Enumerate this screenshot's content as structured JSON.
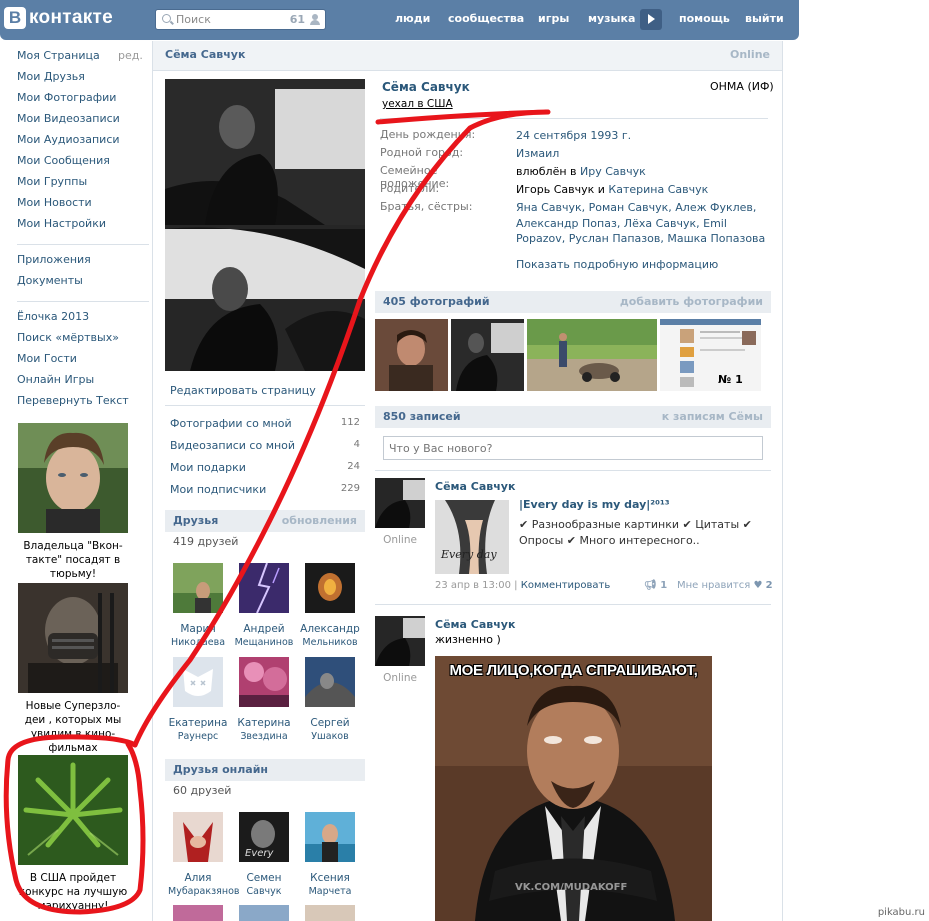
{
  "header": {
    "logo_letter": "В",
    "logo_text": "контакте",
    "search_placeholder": "Поиск",
    "search_count": "61",
    "nav": [
      "люди",
      "сообщества",
      "игры",
      "музыка",
      "помощь",
      "выйти"
    ]
  },
  "left_menu": {
    "edit": "ред.",
    "group1": [
      "Моя Страница",
      "Мои Друзья",
      "Мои Фотографии",
      "Мои Видеозаписи",
      "Мои Аудиозаписи",
      "Мои Сообщения",
      "Мои Группы",
      "Мои Новости",
      "Мои Настройки"
    ],
    "group2": [
      "Приложения",
      "Документы"
    ],
    "group3": [
      "Ёлочка 2013",
      "Поиск «мёртвых»",
      "Мои Гости",
      "Онлайн Игры",
      "Перевернуть Текст"
    ]
  },
  "ads": [
    {
      "text": "Владельца \"Вкон-такте\" посадят в тюрьму!"
    },
    {
      "text": "Новые Суперзло-деи , которых мы увидим в кино-фильмах"
    },
    {
      "text": "В США пройдет конкурс на лучшую марихуанну!"
    }
  ],
  "page_header": {
    "name": "Сёма Савчук",
    "online": "Online"
  },
  "sidebar": {
    "edit_page": "Редактировать страницу",
    "counters": [
      {
        "label": "Фотографии со мной",
        "count": "112"
      },
      {
        "label": "Видеозаписи со мной",
        "count": "4"
      },
      {
        "label": "Мои подарки",
        "count": "24"
      },
      {
        "label": "Мои подписчики",
        "count": "229"
      }
    ],
    "friends": {
      "title": "Друзья",
      "action": "обновления",
      "count_text": "419 друзей",
      "items": [
        {
          "first": "Мария",
          "last": "Николаева"
        },
        {
          "first": "Андрей",
          "last": "Мещанинов"
        },
        {
          "first": "Александр",
          "last": "Мельников"
        },
        {
          "first": "Екатерина",
          "last": "Раунерс"
        },
        {
          "first": "Катерина",
          "last": "Звездина"
        },
        {
          "first": "Сергей",
          "last": "Ушаков"
        }
      ]
    },
    "friends_online": {
      "title": "Друзья онлайн",
      "count_text": "60 друзей",
      "items": [
        {
          "first": "Алия",
          "last": "Мубаракзянов"
        },
        {
          "first": "Семен",
          "last": "Савчук"
        },
        {
          "first": "Ксения",
          "last": "Марчета"
        }
      ]
    }
  },
  "profile": {
    "name": "Сёма Савчук",
    "status": "уехал в США",
    "university": "ОНМА (ИФ)",
    "rows": [
      {
        "label": "День рождения:",
        "value": "24 сентября 1993 г."
      },
      {
        "label": "Родной город:",
        "value": "Измаил"
      },
      {
        "label": "Семейное положение:",
        "value_plain": "влюблён в",
        "value": "Иру Савчук"
      },
      {
        "label": "Родители:",
        "value_a": "Игорь Савчук",
        "value_and": "и",
        "value_b": "Катерина Савчук"
      },
      {
        "label": "Братья, сёстры:",
        "value": "Яна Савчук, Роман Савчук, Алеж Фуклев, Александр Попаз, Лёха Савчук, Emil Popazov, Руслан Папазов, Машка Попазова"
      }
    ],
    "show_more": "Показать подробную информацию"
  },
  "photos_block": {
    "title": "405 фотографий",
    "action": "добавить фотографии",
    "badge": "№ 1"
  },
  "wall": {
    "title": "850 записей",
    "action": "к записям Сёмы",
    "input_placeholder": "Что у Вас нового?",
    "posts": [
      {
        "author": "Сёма Савчук",
        "online": "Online",
        "repost_title": "|Every day is my day|²⁰¹³",
        "repost_text": "✔ Разнообразные картинки ✔ Цитаты ✔ Опросы ✔ Много интересного..",
        "thumb_text": "Every day",
        "date": "23 апр в 13:00",
        "comment": "Комментировать",
        "shares": "1",
        "like_label": "Мне нравится",
        "likes": "2"
      },
      {
        "author": "Сёма Савчук",
        "online": "Online",
        "text": "жизненно )",
        "meme_caption": "МОЕ ЛИЦО,КОГДА СПРАШИВАЮТ,",
        "meme_watermark": "VK.COM/MUDAKOFF"
      }
    ]
  },
  "watermark": "pikabu.ru",
  "colors": {
    "header": "#5b7fa6",
    "link": "#2b587a",
    "annotation": "#e8151b"
  }
}
